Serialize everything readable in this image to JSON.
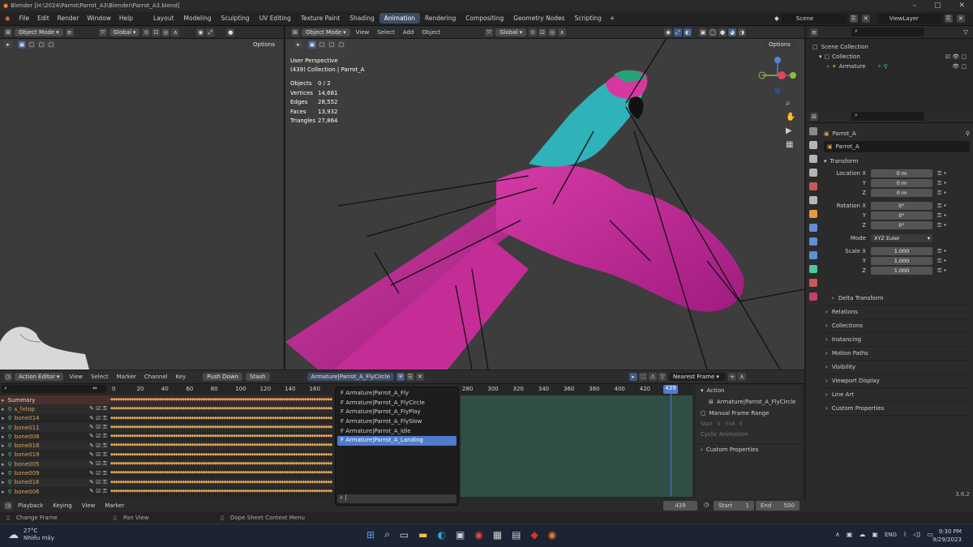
{
  "window": {
    "title": "Blender [H:\\2024\\Parrot\\Parrot_A3\\Blender\\Parrot_A3.blend]"
  },
  "menu": {
    "items": [
      "File",
      "Edit",
      "Render",
      "Window",
      "Help"
    ],
    "workspaces": [
      "Layout",
      "Modeling",
      "Sculpting",
      "UV Editing",
      "Texture Paint",
      "Shading",
      "Animation",
      "Rendering",
      "Compositing",
      "Geometry Nodes",
      "Scripting"
    ],
    "active_workspace": "Animation",
    "scene": "Scene",
    "view_layer": "ViewLayer"
  },
  "left_view": {
    "mode": "Object Mode",
    "orientation": "Global",
    "options": "Options"
  },
  "main_view": {
    "mode": "Object Mode",
    "menus": [
      "View",
      "Select",
      "Add",
      "Object"
    ],
    "orientation": "Global",
    "options": "Options",
    "perspective": "User Perspective",
    "collection_info": "(439) Collection | Parrot_A",
    "stats": [
      {
        "label": "Objects",
        "value": "0 / 2"
      },
      {
        "label": "Vertices",
        "value": "14,681"
      },
      {
        "label": "Edges",
        "value": "28,552"
      },
      {
        "label": "Faces",
        "value": "13,932"
      },
      {
        "label": "Triangles",
        "value": "27,864"
      }
    ]
  },
  "outliner": {
    "scene_collection": "Scene Collection",
    "collection": "Collection",
    "armature": "Armature"
  },
  "props": {
    "object_name": "Parrot_A",
    "data_name": "Parrot_A",
    "transform": "Transform",
    "location": [
      {
        "axis": "Location X",
        "value": "0 m"
      },
      {
        "axis": "Y",
        "value": "0 m"
      },
      {
        "axis": "Z",
        "value": "0 m"
      }
    ],
    "rotation": [
      {
        "axis": "Rotation X",
        "value": "0°"
      },
      {
        "axis": "Y",
        "value": "0°"
      },
      {
        "axis": "Z",
        "value": "0°"
      }
    ],
    "mode_label": "Mode",
    "mode_value": "XYZ Euler",
    "scale": [
      {
        "axis": "Scale X",
        "value": "1.000"
      },
      {
        "axis": "Y",
        "value": "1.000"
      },
      {
        "axis": "Z",
        "value": "1.000"
      }
    ],
    "panels": [
      "Delta Transform",
      "Relations",
      "Collections",
      "Instancing",
      "Motion Paths",
      "Visibility",
      "Viewport Display",
      "Line Art",
      "Custom Properties"
    ]
  },
  "dope": {
    "editor": "Action Editor",
    "menus": [
      "View",
      "Select",
      "Marker",
      "Channel",
      "Key"
    ],
    "push_down": "Push Down",
    "stash": "Stash",
    "action": "Armature|Parrot_A_FlyCircle",
    "interp": "Nearest Frame",
    "ruler_left": [
      "0",
      "20",
      "40",
      "60",
      "80",
      "100",
      "120",
      "140",
      "160"
    ],
    "ruler_right": [
      "280",
      "300",
      "320",
      "340",
      "360",
      "380",
      "400",
      "420"
    ],
    "current_frame": "439",
    "channels": [
      "Summary",
      "s_fxtop",
      "bone014",
      "bone011",
      "bone008",
      "bone018",
      "bone019",
      "bone005",
      "bone009",
      "bone016",
      "bone006"
    ],
    "actions": [
      "Armature|Parrot_A_Fly",
      "Armature|Parrot_A_FlyCircle",
      "Armature|Parrot_A_FlyPlay",
      "Armature|Parrot_A_FlySlow",
      "Armature|Parrot_A_Idle",
      "Armature|Parrot_A_Landing"
    ],
    "selected_action": 5,
    "side": {
      "action_panel": "Action",
      "action_name": "Armature|Parrot_A_FlyCircle",
      "manual_frame": "Manual Frame Range",
      "start": "Start",
      "start_val": "0",
      "end": "End",
      "end_val": "0",
      "cyclic": "Cyclic Animation",
      "custom": "Custom Properties"
    }
  },
  "playback": {
    "items": [
      "Playback",
      "Keying",
      "View",
      "Marker"
    ],
    "frame": "439",
    "start_label": "Start",
    "start": "1",
    "end_label": "End",
    "end": "500"
  },
  "status": {
    "left": "Change Frame",
    "mid": "Pan View",
    "right": "Dope Sheet Context Menu",
    "version": "3.6.2"
  },
  "taskbar": {
    "temp": "27°C",
    "weather": "Nhiều mây",
    "lang": "ENG",
    "time": "9:30 PM",
    "date": "9/29/2023"
  }
}
